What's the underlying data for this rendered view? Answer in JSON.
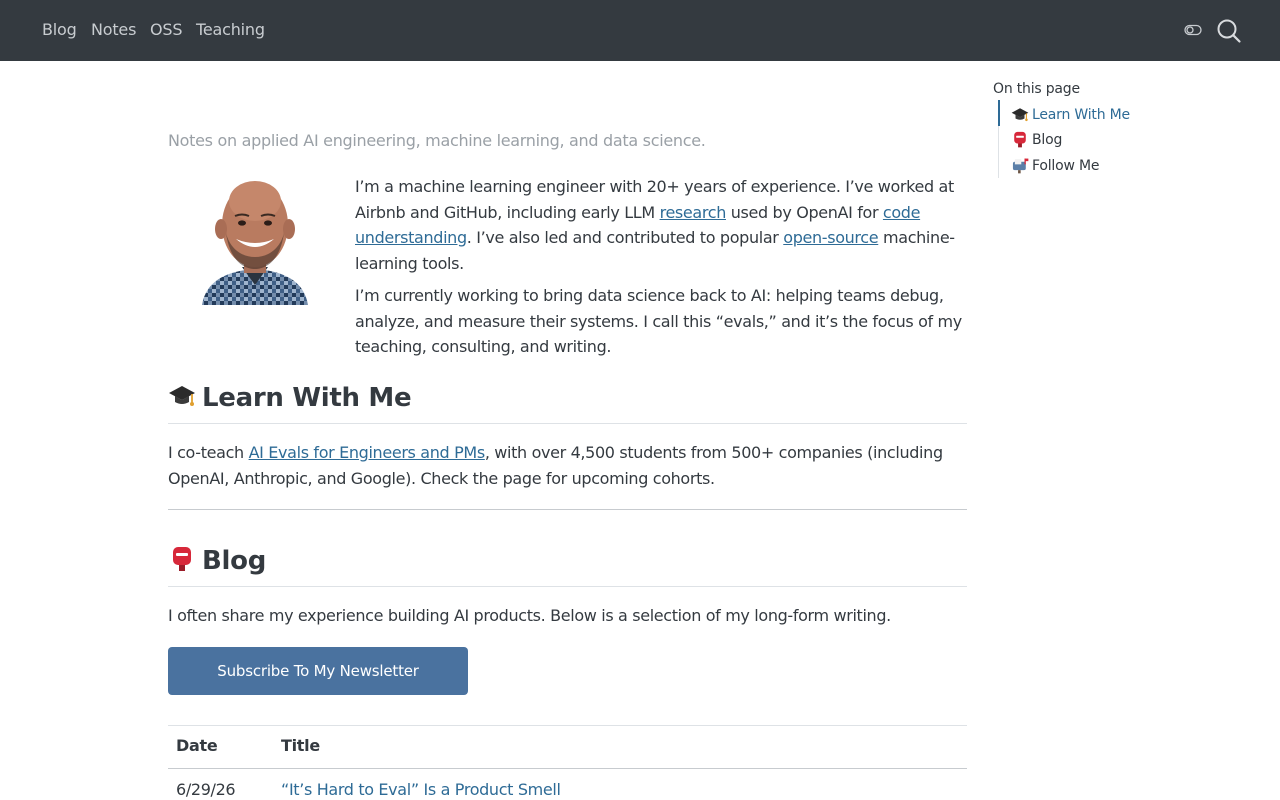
{
  "nav": {
    "links": [
      "Blog",
      "Notes",
      "OSS",
      "Teaching"
    ],
    "icons": [
      "toggle-icon",
      "search-icon"
    ]
  },
  "tagline": "Notes on applied AI engineering, machine learning, and data science.",
  "intro": {
    "p1_before": "I’m a machine learning engineer with 20+ years of experience. I’ve worked at Airbnb and GitHub, including early LLM ",
    "p1_link1": "research",
    "p1_mid1": " used by OpenAI for ",
    "p1_link2": "code understanding",
    "p1_mid2": ". I’ve also led and contributed to popular ",
    "p1_link3": "open-source",
    "p1_after": " machine-learning tools.",
    "p2": "I’m currently working to bring data science back to AI: helping teams debug, analyze, and measure their systems. I call this “evals,” and it’s the focus of my teaching, consulting, and writing."
  },
  "learn": {
    "heading": "Learn With Me",
    "icon": "graduation-cap-icon",
    "text_before": "I co-teach ",
    "link": "AI Evals for Engineers and PMs",
    "text_after": ", with over 4,500 students from 500+ companies (including OpenAI, Anthropic, and Google). Check the page for upcoming cohorts."
  },
  "blog": {
    "heading": "Blog",
    "icon": "postbox-icon",
    "text": "I often share my experience building AI products. Below is a selection of my long-form writing.",
    "subscribe_label": "Subscribe To My Newsletter",
    "table": {
      "headers": [
        "Date",
        "Title"
      ],
      "rows": [
        {
          "date": "6/29/26",
          "title": "“It’s Hard to Eval” Is a Product Smell"
        }
      ]
    }
  },
  "toc": {
    "title": "On this page",
    "items": [
      {
        "label": "Learn With Me",
        "icon": "graduation-cap-icon",
        "active": true
      },
      {
        "label": "Blog",
        "icon": "postbox-icon",
        "active": false
      },
      {
        "label": "Follow Me",
        "icon": "mailbox-icon",
        "active": false
      }
    ]
  },
  "colors": {
    "navbar": "#343a40",
    "link": "#2e6b96",
    "button": "#4a729f"
  }
}
